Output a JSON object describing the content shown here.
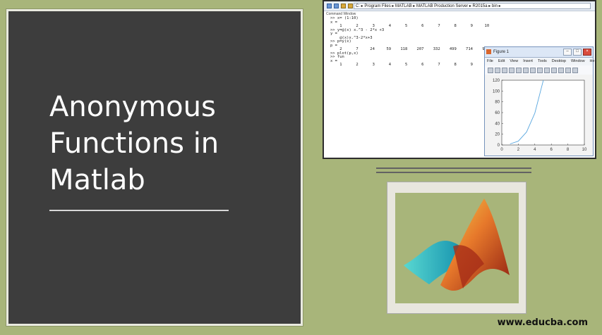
{
  "slide": {
    "title_line_1": "Anonymous",
    "title_line_2": "Functions in",
    "title_line_3": "Matlab",
    "site": "www.educba.com"
  },
  "matlab": {
    "path": "C: ▸ Program Files ▸ MATLAB ▸ MATLAB Production Server ▸ R2015a ▸ bin ▸",
    "panel_label": "Command Window",
    "console": [
      ">> x= (1:10)",
      "",
      "x =",
      "",
      "    1      2      3      4      5      6      7      8      9     10",
      "",
      ">> y=@(x) x.^3 - 2*x +3",
      "",
      "y =",
      "",
      "    @(x)x.^3-2*x+3",
      "",
      ">> p=y(x)",
      "",
      "p =",
      "",
      "    2      7     24     59    118    207    332    499    714    983",
      "",
      ">> plot(p,x)",
      ">> fun",
      "",
      "x =",
      "",
      "    1      2      3      4      5      6      7      8      9     10"
    ],
    "figure": {
      "title": "Figure 1",
      "menu": [
        "File",
        "Edit",
        "View",
        "Insert",
        "Tools",
        "Desktop",
        "Window",
        "Help"
      ],
      "buttons": {
        "minimize": "–",
        "maximize": "□",
        "close": "×"
      }
    }
  },
  "chart_data": {
    "type": "line",
    "x": [
      1,
      2,
      3,
      4,
      5,
      6,
      7,
      8,
      9,
      10
    ],
    "series": [
      {
        "values": [
          2,
          7,
          24,
          59,
          118,
          207,
          332,
          499,
          714,
          983
        ]
      }
    ],
    "xlim": [
      0,
      10
    ],
    "ylim": [
      0,
      120
    ],
    "xticks": [
      0,
      2,
      4,
      6,
      8,
      10
    ],
    "yticks": [
      0,
      20,
      40,
      60,
      80,
      100,
      120
    ],
    "line_color": "#5aa7df"
  },
  "colors": {
    "background": "#a8b57a",
    "panel": "#3d3d3d",
    "text_light": "#ffffff"
  }
}
